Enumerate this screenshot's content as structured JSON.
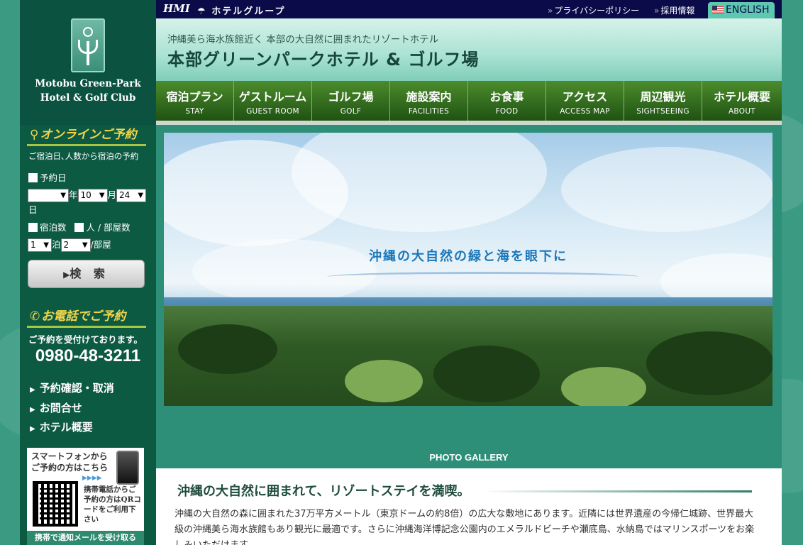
{
  "sidebar": {
    "logo_line1": "Motobu Green-Park",
    "logo_line2": "Hotel & Golf Club",
    "online": {
      "title": "オンラインご予約",
      "subtitle": "ご宿泊日､人数から宿泊の予約",
      "date_label": "予約日",
      "year_value": "",
      "year_suffix": "年",
      "month_value": "10",
      "month_suffix": "月",
      "day_value": "24",
      "day_suffix": "日",
      "nights_label": "宿泊数",
      "people_label": "人 / 部屋数",
      "nights_value": "1",
      "nights_suffix": "泊",
      "people_value": "2",
      "people_suffix": "/部屋",
      "search_button": "検 索"
    },
    "phone": {
      "title": "お電話でご予約",
      "subtitle": "ご予約を受付けております。",
      "number": "0980-48-3211"
    },
    "links": [
      "予約確認・取消",
      "お問合せ",
      "ホテル概要"
    ],
    "mobile": {
      "headline": "スマートフォンからご予約の方はこちら",
      "qr_text": "携帯電話からご予約の方はQRコードをご利用下さい",
      "bottom": "携帯で通知メールを受け取る"
    }
  },
  "topbar": {
    "brand": "HMI",
    "group": "ホテルグループ",
    "privacy": "プライバシーポリシー",
    "recruit": "採用情報",
    "english": "ENGLISH"
  },
  "header": {
    "tagline": "沖縄美ら海水族館近く 本部の大自然に囲まれたリゾートホテル",
    "hotel_name": "本部グリーンパークホテル & ゴルフ場"
  },
  "nav": [
    {
      "jp": "宿泊プラン",
      "en": "STAY"
    },
    {
      "jp": "ゲストルーム",
      "en": "GUEST ROOM"
    },
    {
      "jp": "ゴルフ場",
      "en": "GOLF"
    },
    {
      "jp": "施設案内",
      "en": "FACILITIES"
    },
    {
      "jp": "お食事",
      "en": "FOOD"
    },
    {
      "jp": "アクセス",
      "en": "ACCESS MAP"
    },
    {
      "jp": "周辺観光",
      "en": "SIGHTSEEING"
    },
    {
      "jp": "ホテル概要",
      "en": "ABOUT"
    }
  ],
  "hero": {
    "copy": "沖縄の大自然の緑と海を眼下に"
  },
  "gallery_label": "PHOTO GALLERY",
  "content": {
    "heading": "沖縄の大自然に囲まれて、リゾートステイを満喫。",
    "body": "沖縄の大自然の森に囲まれた37万平方メートル（東京ドームの約8倍）の広大な敷地にあります。近隣には世界遺産の今帰仁城跡、世界最大級の沖縄美ら海水族館もあり観光に最適です。さらに沖縄海洋博記念公園内のエメラルドビーチや瀬底島、水納島ではマリンスポーツをお楽しみいただけます。"
  },
  "colors": {
    "sidebar_bg": "#0d5a43",
    "accent_yellow": "#f3d54a",
    "nav_green": "#2f6b1d",
    "topbar_navy": "#0b0b4a"
  }
}
